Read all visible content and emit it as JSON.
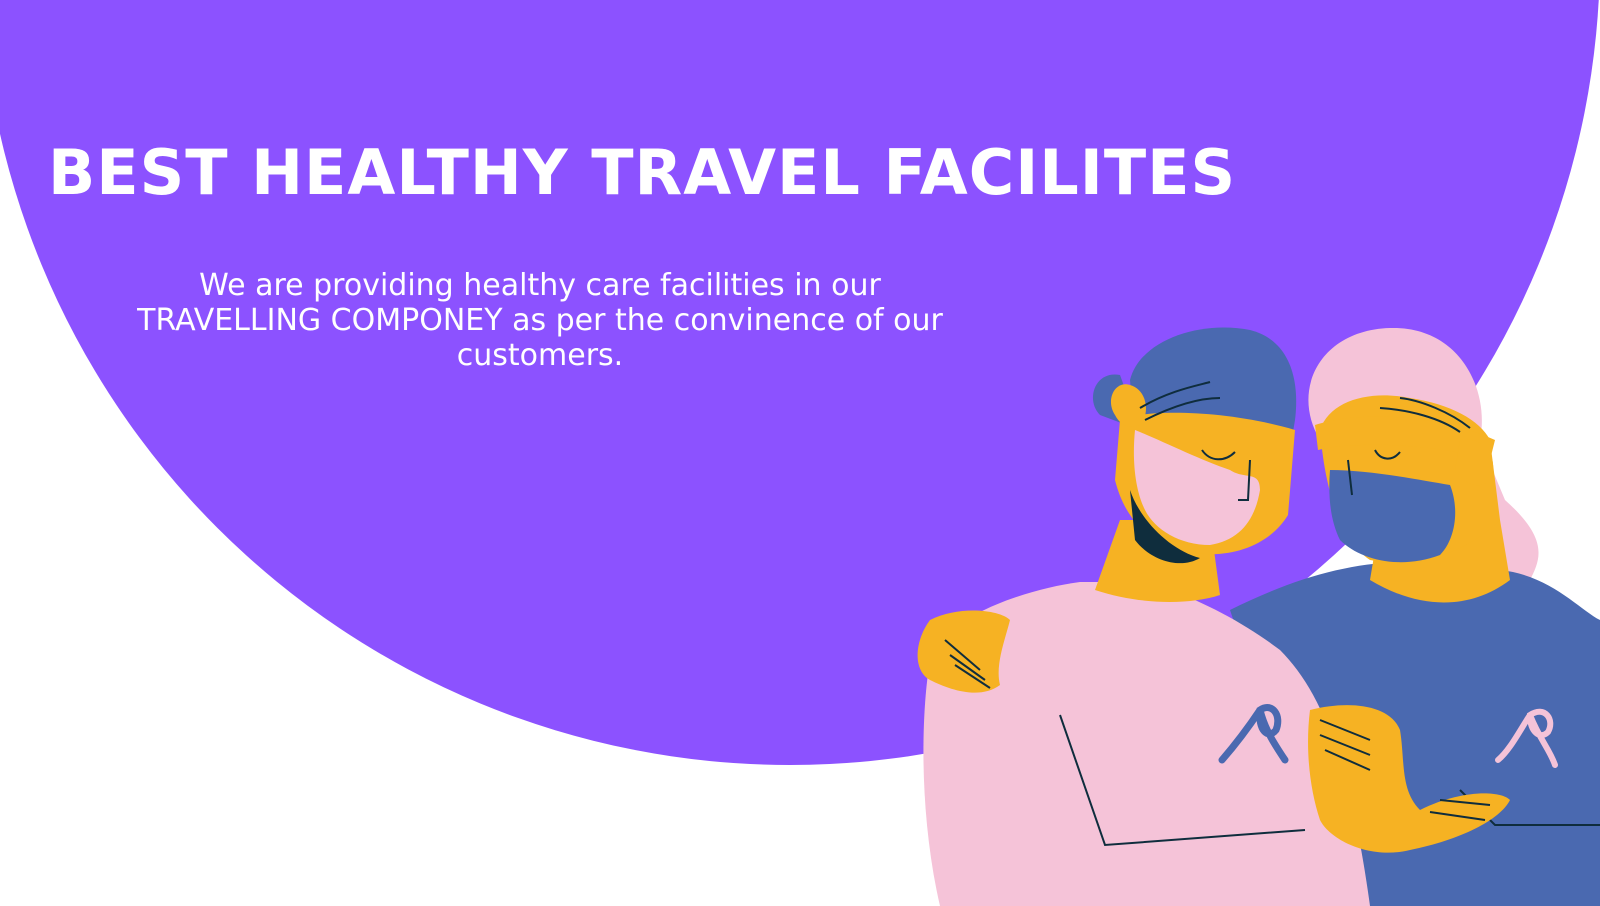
{
  "slide": {
    "title": "BEST HEALTHY TRAVEL FACILITES",
    "subtitle": "We are providing healthy care facilities in our TRAVELLING COMPONEY as per the convinence of our customers."
  },
  "colors": {
    "accent_purple": "#8c52ff",
    "background": "#ffffff",
    "skin": "#f6b223",
    "pink": "#f5c3d8",
    "blue": "#4a69b0",
    "dark_line": "#0f2d3d"
  },
  "illustration": {
    "icon": "two-masked-people-awareness-ribbons-illustration"
  }
}
